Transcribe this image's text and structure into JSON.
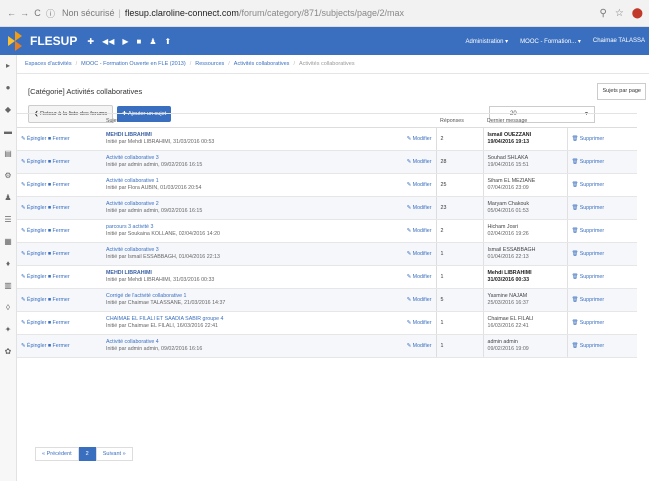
{
  "browser": {
    "insecure_label": "Non sécurisé",
    "host": "flesup.claroline-connect.com",
    "path": "/forum/category/871/subjects/page/2/max"
  },
  "topbar": {
    "brand": "FLESUP",
    "menus": [
      "Administration ▾",
      "MOOC - Formation... ▾",
      "Chaimae TALASSA"
    ],
    "bg_color": "#3a6fbf"
  },
  "breadcrumb": [
    "Espaces d'activités",
    "MOOC - Formation Ouverte en FLE (2013)",
    "Ressources",
    "Activités collaboratives",
    "Activités collaboratives"
  ],
  "page_title": "[Catégorie] Activités collaboratives",
  "toolbar": {
    "back_label": "Retour à la liste des forums",
    "add_label": "Ajouter un sujet",
    "per_page_value": "20",
    "per_page_label": "Sujets par page"
  },
  "table": {
    "headers": {
      "subject": "Sujet",
      "replies": "Réponses",
      "last": "Dernier message"
    },
    "action_pin": "Épingler",
    "action_close": "Fermer",
    "action_edit": "Modifier",
    "action_delete": "Supprimer",
    "rows": [
      {
        "title": "MEHDI LIBRAHIMI",
        "by": "Initié par Mehdi LIBRAHIMI, 31/03/2016 00:53",
        "replies": "2",
        "last_name": "Ismail OUEZZANI",
        "last_date": "19/04/2016 19:13",
        "highlight": true
      },
      {
        "title": "Activité collaborative 3",
        "by": "Initié par admin admin, 09/02/2016 16:15",
        "replies": "28",
        "last_name": "Souhad SHLAKA",
        "last_date": "19/04/2016 15:51",
        "highlight": false
      },
      {
        "title": "Activité collaborative 1",
        "by": "Initié par Flora AUBIN, 01/03/2016 20:54",
        "replies": "25",
        "last_name": "Siham EL MEZIANE",
        "last_date": "07/04/2016 23:09",
        "highlight": false
      },
      {
        "title": "Activité collaborative 2",
        "by": "Initié par admin admin, 09/02/2016 16:15",
        "replies": "23",
        "last_name": "Maryam Chakouk",
        "last_date": "05/04/2016 01:53",
        "highlight": false
      },
      {
        "title": "parcours 3 activité 3",
        "by": "Initié par Soukaina KOLLANE, 02/04/2016 14:20",
        "replies": "2",
        "last_name": "Hicham Josri",
        "last_date": "02/04/2016 19:26",
        "highlight": false
      },
      {
        "title": "Activité collaborative 3",
        "by": "Initié par Ismail ESSABBAGH, 01/04/2016 22:13",
        "replies": "1",
        "last_name": "Ismail ESSABBAGH",
        "last_date": "01/04/2016 22:13",
        "highlight": false
      },
      {
        "title": "MEHDI LIBRAHIMI",
        "by": "Initié par Mehdi LIBRAHIMI, 31/03/2016 00:33",
        "replies": "1",
        "last_name": "Mehdi LIBRAHIMI",
        "last_date": "31/03/2016 00:33",
        "highlight": true
      },
      {
        "title": "Corrigé de l'activité collaborative 1",
        "by": "Initié par Chaimae TALASSANE, 21/03/2016 14:37",
        "replies": "5",
        "last_name": "Yasmine NAJAM",
        "last_date": "25/03/2016 16:37",
        "highlight": false
      },
      {
        "title": "CHAIMAE EL FILALI ET SAADIA SABIR groupe 4",
        "by": "Initié par Chaimae EL FILALI, 16/03/2016 22:41",
        "replies": "1",
        "last_name": "Chaimae EL FILALI",
        "last_date": "16/03/2016 22:41",
        "highlight": false
      },
      {
        "title": "Activité collaborative 4",
        "by": "Initié par admin admin, 09/02/2016 16:16",
        "replies": "1",
        "last_name": "admin admin",
        "last_date": "09/02/2016 19:09",
        "highlight": false
      }
    ]
  },
  "pager": {
    "prev": "« Précédent",
    "current": "2",
    "next": "Suivant »"
  }
}
